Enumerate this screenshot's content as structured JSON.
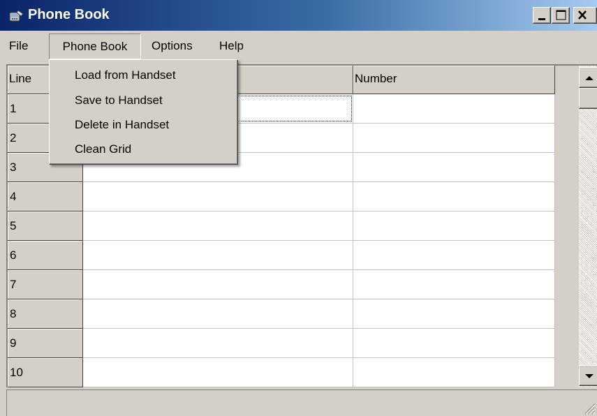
{
  "window": {
    "title": "Phone Book",
    "icon": "phone-book-app-icon",
    "controls": [
      "minimize-icon",
      "maximize-icon",
      "close-icon"
    ]
  },
  "menubar": {
    "items": [
      "File",
      "Phone Book",
      "Options",
      "Help"
    ],
    "active": "Phone Book"
  },
  "dropdown": {
    "items": [
      "Load from Handset",
      "Save to Handset",
      "Delete in Handset",
      "Clean Grid"
    ]
  },
  "grid": {
    "columns": [
      "Line",
      "",
      "Number"
    ],
    "rows": [
      {
        "line": "1",
        "name": "",
        "number": ""
      },
      {
        "line": "2",
        "name": "",
        "number": ""
      },
      {
        "line": "3",
        "name": "",
        "number": ""
      },
      {
        "line": "4",
        "name": "",
        "number": ""
      },
      {
        "line": "5",
        "name": "",
        "number": ""
      },
      {
        "line": "6",
        "name": "",
        "number": ""
      },
      {
        "line": "7",
        "name": "",
        "number": ""
      },
      {
        "line": "8",
        "name": "",
        "number": ""
      },
      {
        "line": "9",
        "name": "",
        "number": ""
      },
      {
        "line": "10",
        "name": "",
        "number": ""
      }
    ],
    "focused_row": 1
  },
  "scrollbar": {
    "icons": [
      "arrow-up-icon",
      "arrow-down-icon"
    ]
  },
  "statusbar": {
    "text": ""
  }
}
